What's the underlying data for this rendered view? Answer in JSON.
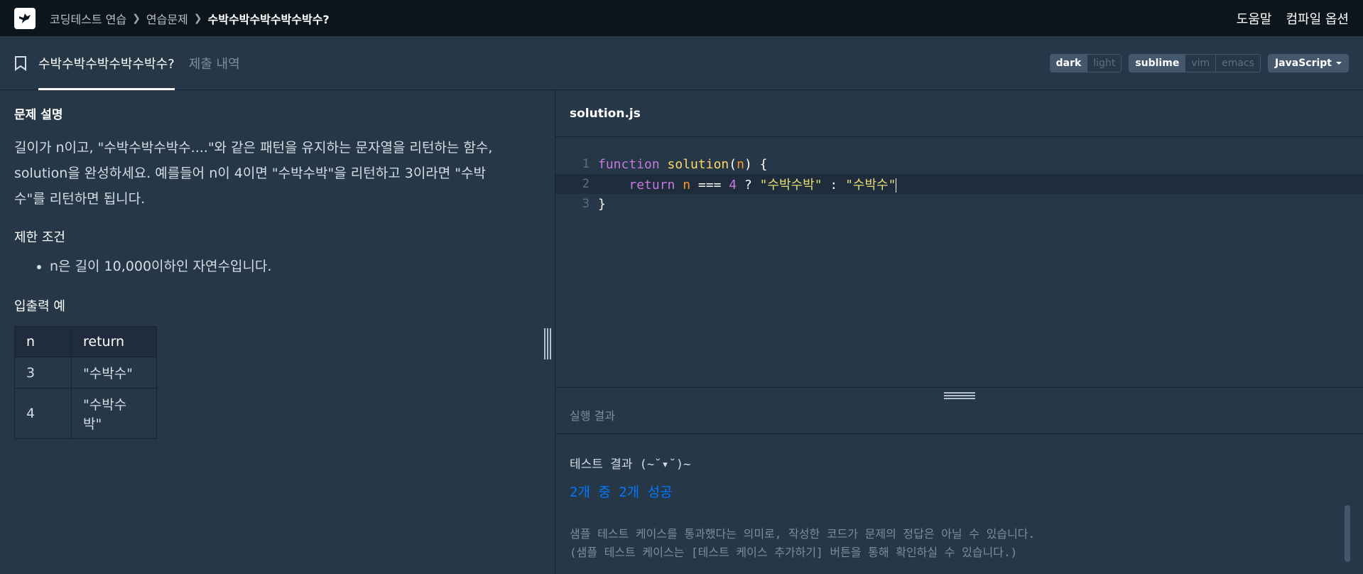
{
  "nav": {
    "breadcrumbs": [
      "코딩테스트 연습",
      "연습문제",
      "수박수박수박수박수박수?"
    ],
    "help": "도움말",
    "compile_options": "컴파일 옵션"
  },
  "tabs": {
    "problem": "수박수박수박수박수박수?",
    "submissions": "제출 내역"
  },
  "controls": {
    "theme": [
      "dark",
      "light"
    ],
    "theme_selected": "dark",
    "keymap": [
      "sublime",
      "vim",
      "emacs"
    ],
    "keymap_selected": "sublime",
    "language": "JavaScript"
  },
  "problem": {
    "description_title": "문제 설명",
    "description": "길이가 n이고, \"수박수박수박수....\"와 같은 패턴을 유지하는 문자열을 리턴하는 함수, solution을 완성하세요. 예를들어 n이 4이면 \"수박수박\"을 리턴하고 3이라면 \"수박수\"를 리턴하면 됩니다.",
    "constraints_title": "제한 조건",
    "constraints": [
      "n은 길이 10,000이하인 자연수입니다."
    ],
    "examples_title": "입출력 예",
    "table": {
      "headers": [
        "n",
        "return"
      ],
      "rows": [
        [
          "3",
          "\"수박수\""
        ],
        [
          "4",
          "\"수박수박\""
        ]
      ]
    }
  },
  "editor": {
    "filename": "solution.js",
    "line_numbers": [
      "1",
      "2",
      "3"
    ],
    "code": {
      "l1_kw": "function",
      "l1_fn": "solution",
      "l1_open": "(",
      "l1_param": "n",
      "l1_close": ") {",
      "l2_kw": "return",
      "l2_var": "n",
      "l2_op": " === ",
      "l2_num": "4",
      "l2_q": " ? ",
      "l2_str1": "\"수박수박\"",
      "l2_colon": " : ",
      "l2_str2": "\"수박수\"",
      "l3": "}"
    }
  },
  "result": {
    "header": "실행 결과",
    "title": "테스트 결과 (~˘▾˘)~",
    "success": "2개 중 2개 성공",
    "note_line1": "샘플 테스트 케이스를 통과했다는 의미로, 작성한 코드가 문제의 정답은 아닐 수 있습니다.",
    "note_line2": "(샘플 테스트 케이스는 [테스트 케이스 추가하기] 버튼을 통해 확인하실 수 있습니다.)"
  },
  "colors": {
    "navbar_bg": "#0c151c",
    "panel_bg": "#263747",
    "accent_blue": "#0078ff"
  }
}
